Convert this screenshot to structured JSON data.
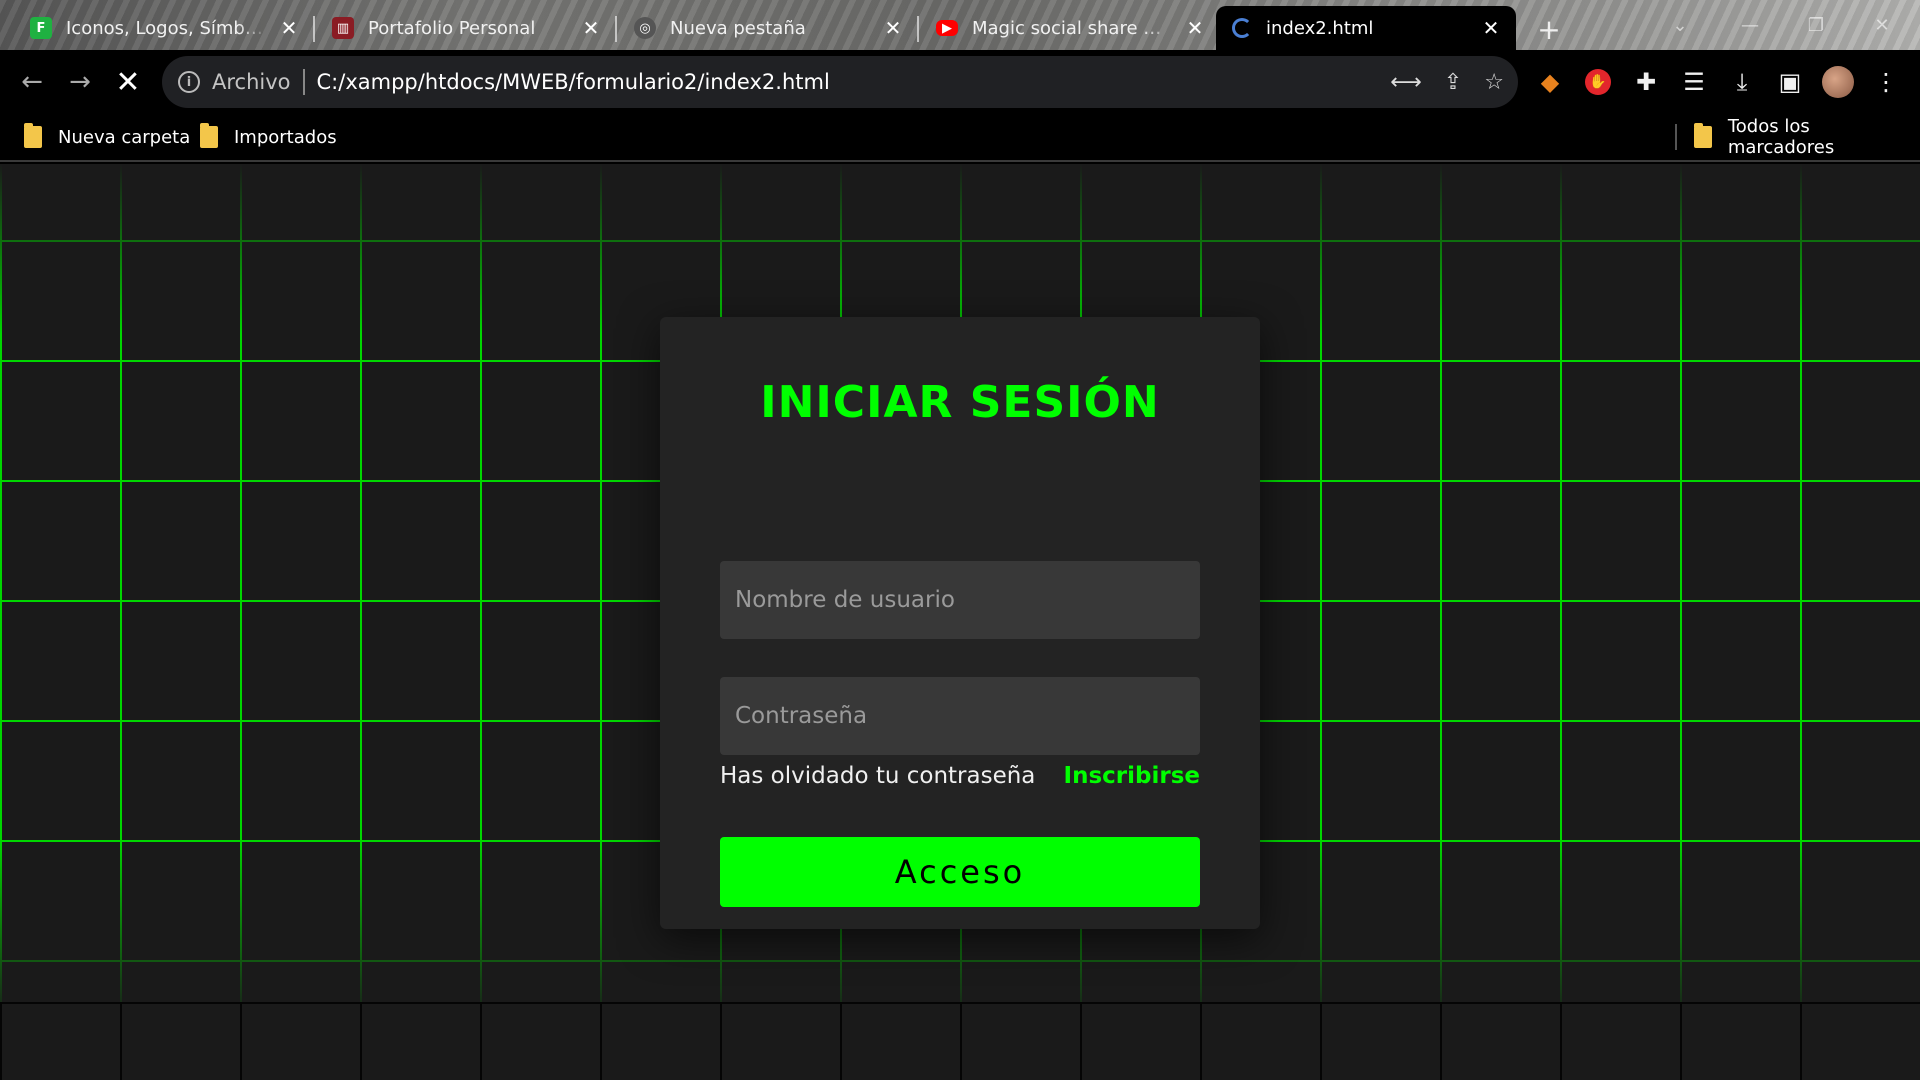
{
  "browser": {
    "tabs": [
      {
        "title": "Iconos, Logos, Símbolos",
        "icon": "flaticon-favicon"
      },
      {
        "title": "Portafolio Personal",
        "icon": "portfolio-favicon"
      },
      {
        "title": "Nueva pestaña",
        "icon": "chrome-favicon"
      },
      {
        "title": "Magic social share menu",
        "icon": "youtube-favicon"
      },
      {
        "title": "index2.html",
        "icon": "loading-favicon"
      }
    ],
    "omnibox": {
      "scheme_label": "Archivo",
      "url": "C:/xampp/htdocs/MWEB/formulario2/index2.html"
    },
    "bookmarks": {
      "items": [
        "Nueva carpeta",
        "Importados"
      ],
      "all_bookmarks": "Todos los marcadores"
    }
  },
  "login": {
    "title": "INICIAR SESIÓN",
    "username_placeholder": "Nombre de usuario",
    "password_placeholder": "Contraseña",
    "forgot_label": "Has olvidado tu contraseña",
    "signup_label": "Inscribirse",
    "submit_label": "Acceso"
  },
  "colors": {
    "accent": "#00ff00",
    "card_bg": "#232323",
    "page_bg": "#1a1a1a",
    "input_bg": "#383838"
  }
}
